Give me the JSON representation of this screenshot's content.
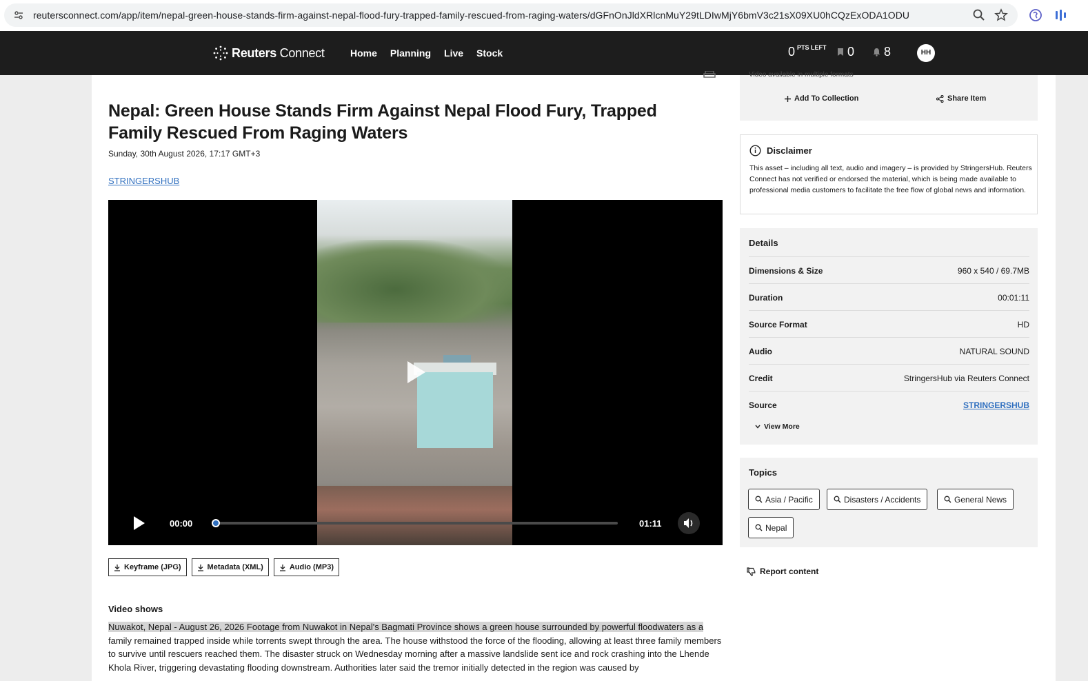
{
  "browser": {
    "url": "reutersconnect.com/app/item/nepal-green-house-stands-firm-against-nepal-flood-fury-trapped-family-rescued-from-raging-waters/dGFnOnJldXRlcnMuY29tLDIwMjY6bmV3c21sX09XU0hCQzExODA1ODU"
  },
  "header": {
    "brand_bold": "Reuters",
    "brand_light": " Connect",
    "nav": [
      "Home",
      "Planning",
      "Live",
      "Stock"
    ],
    "points": "0",
    "points_label": "PTS LEFT",
    "saved_count": "0",
    "notifications_count": "8",
    "avatar_initials": "HH"
  },
  "article": {
    "title": "Nepal: Green House Stands Firm Against Nepal Flood Fury, Trapped Family Rescued From Raging Waters",
    "date": "Sunday, 30th August 2026, 17:17 GMT+3",
    "provider": "STRINGERSHUB",
    "video": {
      "current_time": "00:00",
      "duration": "01:11",
      "progress": 0
    },
    "downloads": [
      "Keyframe (JPG)",
      "Metadata (XML)",
      "Audio (MP3)"
    ],
    "video_shows_label": "Video shows",
    "body_highlight": "Nuwakot, Nepal - August 26, 2026 Footage from Nuwakot in Nepal's Bagmati Province shows a green house surrounded by powerful floodwaters as a",
    "body_rest": " family remained trapped inside while torrents swept through the area. The house withstood the force of the flooding, allowing at least three family members to survive until rescuers reached them. The disaster struck on Wednesday morning after a massive landslide sent ice and rock crashing into the Lhende Khola River, triggering devastating flooding downstream. Authorities later said the tremor initially detected in the region was caused by"
  },
  "actions": {
    "formats_note": "Video available in multiple formats",
    "add_to_collection": "Add To Collection",
    "share_item": "Share Item"
  },
  "disclaimer": {
    "title": "Disclaimer",
    "text": "This asset – including all text, audio and imagery – is provided by StringersHub. Reuters Connect has not verified or endorsed the material, which is being made available to professional media customers to facilitate the free flow of global news and information."
  },
  "details": {
    "title": "Details",
    "rows": [
      {
        "label": "Dimensions & Size",
        "value": "960 x 540 / 69.7MB"
      },
      {
        "label": "Duration",
        "value": "00:01:11"
      },
      {
        "label": "Source Format",
        "value": "HD"
      },
      {
        "label": "Audio",
        "value": "NATURAL SOUND"
      },
      {
        "label": "Credit",
        "value": "StringersHub via Reuters Connect"
      },
      {
        "label": "Source",
        "value": "STRINGERSHUB"
      }
    ],
    "view_more": "View More"
  },
  "topics": {
    "title": "Topics",
    "items": [
      "Asia / Pacific",
      "Disasters / Accidents",
      "General News",
      "Nepal"
    ]
  },
  "report": "Report content",
  "colors": {
    "header_bg": "#1d1d1d",
    "link": "#2f6fbf",
    "panel_bg": "#f2f2f2"
  }
}
